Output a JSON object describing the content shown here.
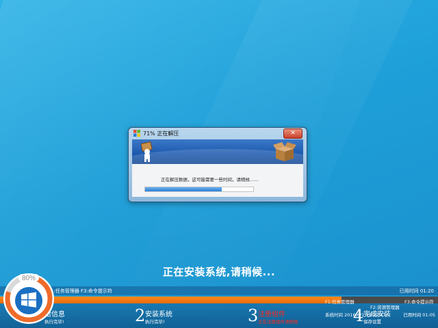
{
  "dialog": {
    "title": "71% 正在解压",
    "close_label": "✕",
    "status_text": "正在解压数据，这可能需要一些时间，请稍候......",
    "progress": 0.71
  },
  "main_message": "正在安装系统,请稍候...",
  "info_bar": {
    "task_manager": "F1:任务管理器",
    "cmd": "F3:命令提示符",
    "elapsed": "已用时间 01:20"
  },
  "overall_progress": 0.78,
  "steps": [
    {
      "num": "",
      "label": "给信息",
      "sub": "执行完毕!"
    },
    {
      "num": "2",
      "label": "安装系统",
      "sub": "执行完毕!"
    },
    {
      "num": "3",
      "label": "注册组件",
      "sub": "正在注册组件请稍候"
    },
    {
      "num": "4",
      "label": "完成安装",
      "sub": "保存设置"
    }
  ],
  "hotkeys": {
    "f1": "F1:任务管理器",
    "f2": "F2:资源管理器",
    "f3": "F3:命令提示符",
    "system_time": "系统时间 2016/6/1 19:29:47",
    "elapsed2": "已用时间 01:05"
  },
  "badge": {
    "percent": "80%",
    "value": 0.8
  },
  "colors": {
    "accent": "#1e9fd8",
    "orange": "#f27b12",
    "active_step": "#ff2a1a"
  }
}
